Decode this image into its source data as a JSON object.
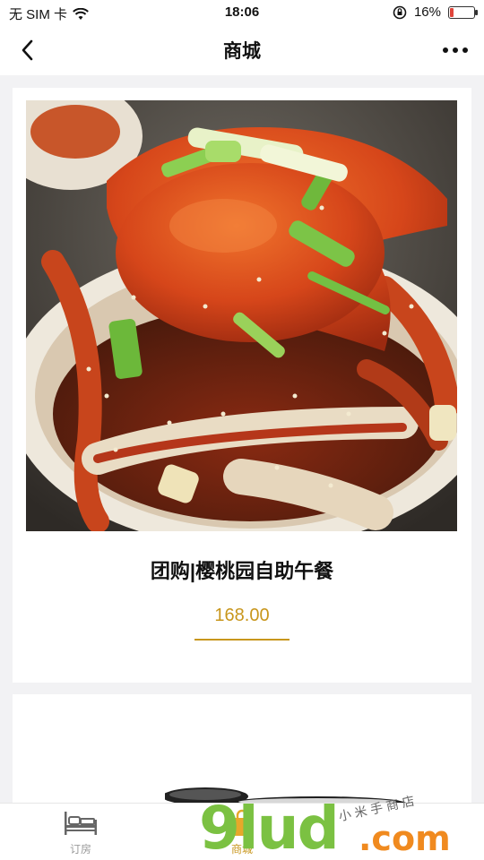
{
  "status_bar": {
    "carrier": "无 SIM 卡",
    "time": "18:06",
    "battery": "16%",
    "battery_level": 0.16,
    "icons": [
      "wifi-icon",
      "rotation-lock-icon",
      "battery-icon"
    ]
  },
  "nav": {
    "title": "商城",
    "back_icon": "chevron-left-icon",
    "more_icon": "more-dots-icon"
  },
  "products": [
    {
      "name": "团购|樱桃园自助午餐",
      "price": "168.00"
    }
  ],
  "tabs": [
    {
      "label": "订房",
      "icon": "bed-icon",
      "active": false
    },
    {
      "label": "商城",
      "icon": "shop-bag-icon",
      "active": true
    }
  ],
  "watermark": {
    "main": "9lud",
    "suffix": ".com",
    "tagline": "小米手商店"
  },
  "colors": {
    "accent": "#c8961c",
    "battery_low": "#e0453b",
    "background": "#f2f2f4"
  }
}
